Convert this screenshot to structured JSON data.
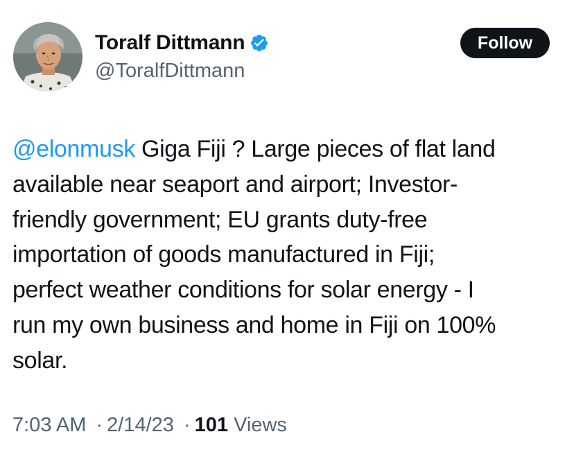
{
  "author": {
    "display_name": "Toralf Dittmann",
    "handle": "@ToralfDittmann",
    "verified": true,
    "verified_icon": "verified-badge-icon",
    "avatar_icon": "profile-photo"
  },
  "follow_button": {
    "label": "Follow"
  },
  "tweet": {
    "mention": "@elonmusk",
    "lines": [
      " Giga Fiji ? Large pieces of flat land",
      "available near seaport and airport; Investor-",
      "friendly government; EU grants duty-free",
      "importation of goods manufactured in Fiji;",
      "perfect weather conditions for solar energy - I",
      "run my own business and home in Fiji on 100%",
      "solar."
    ]
  },
  "meta": {
    "time": "7:03 AM",
    "separator": "·",
    "date": "2/14/23",
    "views_count": "101",
    "views_label": " Views"
  },
  "colors": {
    "text": "#0f1419",
    "secondary": "#536471",
    "link": "#1d9bf0",
    "button_bg": "#0f1419",
    "verified": "#1d9bf0"
  }
}
